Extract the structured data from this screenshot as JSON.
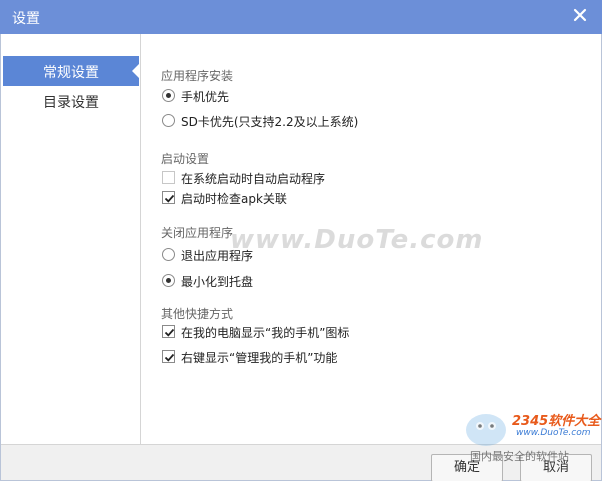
{
  "window": {
    "title": "设置"
  },
  "sidebar": {
    "items": [
      {
        "label": "常规设置",
        "active": true
      },
      {
        "label": "目录设置",
        "active": false
      }
    ]
  },
  "sections": [
    {
      "title": "应用程序安装",
      "options": [
        {
          "type": "radio",
          "label": "手机优先",
          "checked": true
        },
        {
          "type": "radio",
          "label": "SD卡优先(只支持2.2及以上系统)",
          "checked": false
        }
      ]
    },
    {
      "title": "启动设置",
      "options": [
        {
          "type": "checkbox",
          "label": "在系统启动时自动启动程序",
          "checked": false
        },
        {
          "type": "checkbox",
          "label": "启动时检查apk关联",
          "checked": true
        }
      ]
    },
    {
      "title": "关闭应用程序",
      "options": [
        {
          "type": "radio",
          "label": "退出应用程序",
          "checked": false
        },
        {
          "type": "radio",
          "label": "最小化到托盘",
          "checked": true
        }
      ]
    },
    {
      "title": "其他快捷方式",
      "options": [
        {
          "type": "checkbox",
          "label": "在我的电脑显示“我的手机”图标",
          "checked": true
        },
        {
          "type": "checkbox",
          "label": "右键显示“管理我的手机”功能",
          "checked": true
        }
      ]
    }
  ],
  "footer": {
    "ok_label": "确定",
    "cancel_label": "取消"
  },
  "watermarks": {
    "center": "www.DuoTe.com",
    "brand": "2345软件大全",
    "url": "www.DuoTe.com",
    "slogan": "国内最安全的软件站"
  },
  "colors": {
    "titlebar": "#6c8fd8",
    "active_nav": "#5b86d6"
  }
}
